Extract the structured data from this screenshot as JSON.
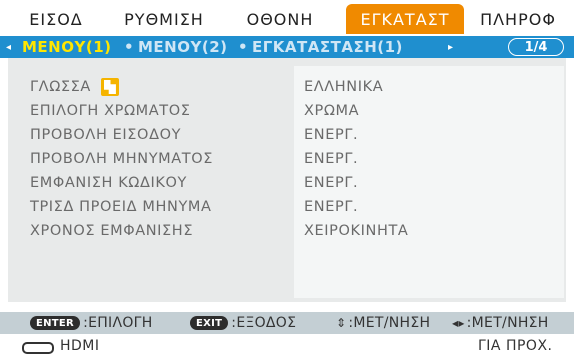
{
  "tabs": [
    {
      "label": "ΕΙΣΟΔ",
      "active": false
    },
    {
      "label": "ΡΥΘΜΙΣΗ",
      "active": false
    },
    {
      "label": "ΟΘΟΝΗ",
      "active": false
    },
    {
      "label": "ΕΓΚΑΤΑΣΤ",
      "active": true
    },
    {
      "label": "ΠΛΗΡΟΦ",
      "active": false
    }
  ],
  "subtabs": {
    "left_arrow": "◂",
    "items": [
      {
        "label": "ΜΕΝΟΥ(1)",
        "active": true
      },
      {
        "label": "ΜΕΝΟΥ(2)",
        "active": false
      },
      {
        "label": "ΕΓΚΑΤΑΣΤΑΣΗ(1)",
        "active": false
      }
    ],
    "separator": "•",
    "right_arrow": "▸",
    "page": "1/4"
  },
  "settings": [
    {
      "label": "ΓΛΩΣΣΑ",
      "value": "ΕΛΛΗΝΙΚΑ",
      "icon": "language-icon"
    },
    {
      "label": "ΕΠΙΛΟΓΗ ΧΡΩΜΑΤΟΣ",
      "value": "ΧΡΩΜΑ"
    },
    {
      "label": "ΠΡΟΒΟΛΗ ΕΙΣΟΔΟΥ",
      "value": "ΕΝΕΡΓ."
    },
    {
      "label": "ΠΡΟΒΟΛΗ ΜΗΝΥΜΑΤΟΣ",
      "value": "ΕΝΕΡΓ."
    },
    {
      "label": "ΕΜΦΑΝΙΣΗ ΚΩΔΙΚΟΥ",
      "value": "ΕΝΕΡΓ."
    },
    {
      "label": "ΤΡΙΣΔ ΠΡΟΕΙΔ ΜΗΝΥΜΑ",
      "value": "ΕΝΕΡΓ."
    },
    {
      "label": "ΧΡΟΝΟΣ ΕΜΦΑΝΙΣΗΣ",
      "value": "ΧΕΙΡΟΚΙΝΗΤΑ"
    }
  ],
  "hints": {
    "enter_key": "ENTER",
    "enter_text": ":ΕΠΙΛΟΓΗ",
    "exit_key": "EXIT",
    "exit_text": ":ΕΞΟΔΟΣ",
    "updown_symbol": "⇕",
    "updown_text": ":ΜΕΤ/ΝΗΣΗ",
    "leftright_symbol": "◂▸",
    "leftright_text": ":ΜΕΤ/ΝΗΣΗ"
  },
  "status": {
    "source": "HDMI",
    "source_icon": "hdmi-port-icon",
    "right_text": "ΓΙΑ ΠΡΟΧ."
  },
  "colors": {
    "active_tab": "#f08a00",
    "subbar": "#1f8fcf",
    "active_subtab": "#ffe600"
  }
}
